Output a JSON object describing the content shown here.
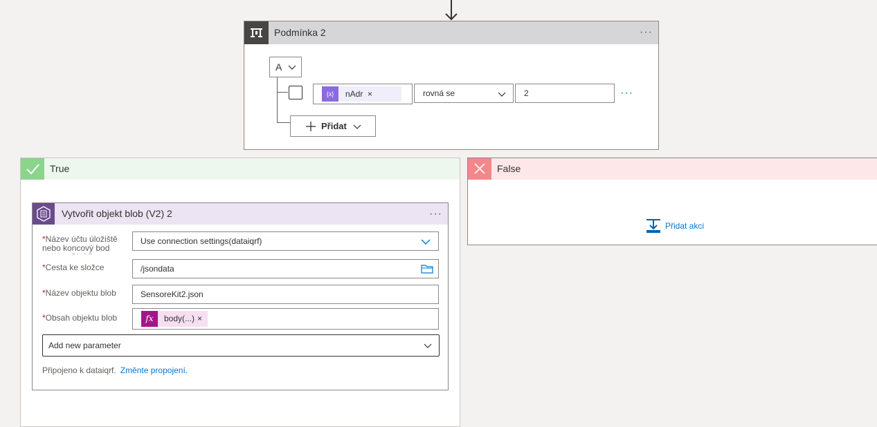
{
  "condition": {
    "title": "Podmínka 2",
    "group_operator": "A",
    "row": {
      "token_icon": "{x}",
      "token_label": "nAdr",
      "token_remove": "×",
      "operator": "rovná se",
      "value": "2"
    },
    "add_label": "Přidat"
  },
  "true_branch": {
    "title": "True"
  },
  "false_branch": {
    "title": "False",
    "add_action_label": "Přidat akci"
  },
  "action": {
    "title": "Vytvořit objekt blob (V2) 2",
    "fields": {
      "account_label": "Název účtu úložiště nebo koncový bod objektu BLOB",
      "account_value": "Use connection settings(dataiqrf)",
      "folder_label": "Cesta ke složce",
      "folder_value": "/jsondata",
      "blob_name_label": "Název objektu blob",
      "blob_name_value": "SensoreKit2.json",
      "content_label": "Obsah objektu blob",
      "content_token_icon": "fx",
      "content_token": "body(...)",
      "content_token_remove": "×"
    },
    "required_marker": "*",
    "add_parameter_placeholder": "Add new parameter",
    "connection_text": "Připojeno k dataiqrf.",
    "change_connection_link": "Změnte propojení."
  },
  "colors": {
    "condition_header": "#d6d6d8",
    "condition_icon_bg": "#484644",
    "true_header": "#eef7ee",
    "true_icon_bg": "#8bd48b",
    "false_header": "#fde7e9",
    "false_icon_bg": "#f3878a",
    "action_header": "#ece4f2",
    "action_icon_bg": "#6a4b8c",
    "variable_token": "#8b6be0",
    "expression_token": "#a3168a",
    "link": "#0078d4"
  },
  "icons": {
    "flow_arrow": "arrow-down-icon",
    "condition": "condition-icon",
    "true": "check-icon",
    "false": "close-icon",
    "action": "blob-storage-icon",
    "add_action": "add-action-icon",
    "folder": "folder-icon",
    "more": "more-icon"
  }
}
